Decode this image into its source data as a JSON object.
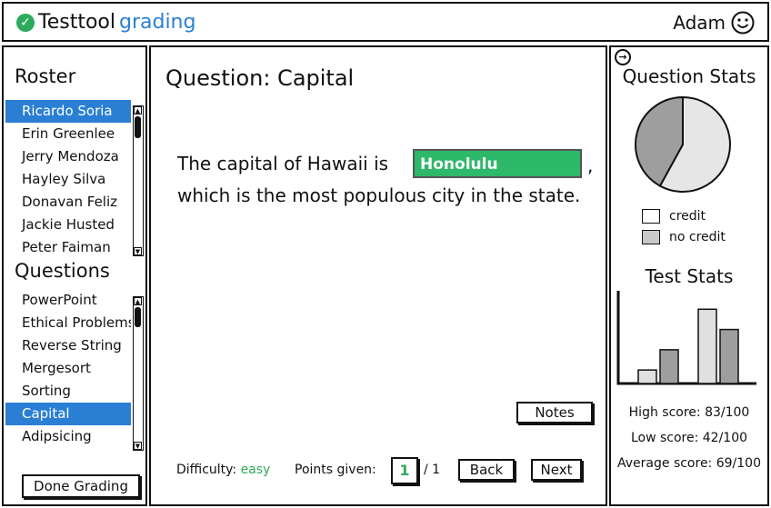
{
  "header": {
    "title_part1": "Testtool",
    "title_part2": "grading",
    "user_name": "Adam"
  },
  "roster": {
    "title": "Roster",
    "students": [
      "Ricardo Soria",
      "Erin Greenlee",
      "Jerry Mendoza",
      "Hayley Silva",
      "Donavan Feliz",
      "Jackie Husted",
      "Peter Faiman"
    ],
    "selected_index": 0
  },
  "questions": {
    "title": "Questions",
    "items": [
      "PowerPoint",
      "Ethical Problems",
      "Reverse String",
      "Mergesort",
      "Sorting",
      "Capital",
      "Adipsicing"
    ],
    "selected_index": 5
  },
  "done_button": "Done Grading",
  "main": {
    "question_title": "Question: Capital",
    "text_before": "The capital of Hawaii is",
    "answer": "Honolulu",
    "text_comma": ",",
    "text_after": "which is the most populous city in the state.",
    "notes_button": "Notes",
    "difficulty_label": "Difficulty:",
    "difficulty_value": "easy",
    "points_label": "Points given:",
    "points_value": "1",
    "points_total": "/ 1",
    "back_button": "Back",
    "next_button": "Next"
  },
  "stats": {
    "question_stats_title": "Question Stats",
    "legend_credit": "credit",
    "legend_no_credit": "no credit",
    "test_stats_title": "Test Stats",
    "high_score": "High score: 83/100",
    "low_score": "Low score: 42/100",
    "average_score": "Average score: 69/100",
    "colors": {
      "credit": "#e6e6e6",
      "no_credit": "#9e9e9e",
      "accent": "#2a7fd4",
      "green": "#2eaa5c"
    }
  },
  "chart_data": [
    {
      "type": "pie",
      "labels": [
        "credit",
        "no credit"
      ],
      "values": [
        58,
        42
      ]
    },
    {
      "type": "bar",
      "series": [
        {
          "values": [
            2,
            5,
            11,
            8
          ]
        }
      ],
      "colors": [
        "#e0e0e0",
        "#9e9e9e",
        "#e0e0e0",
        "#9e9e9e"
      ],
      "ylim": [
        0,
        14
      ]
    }
  ]
}
